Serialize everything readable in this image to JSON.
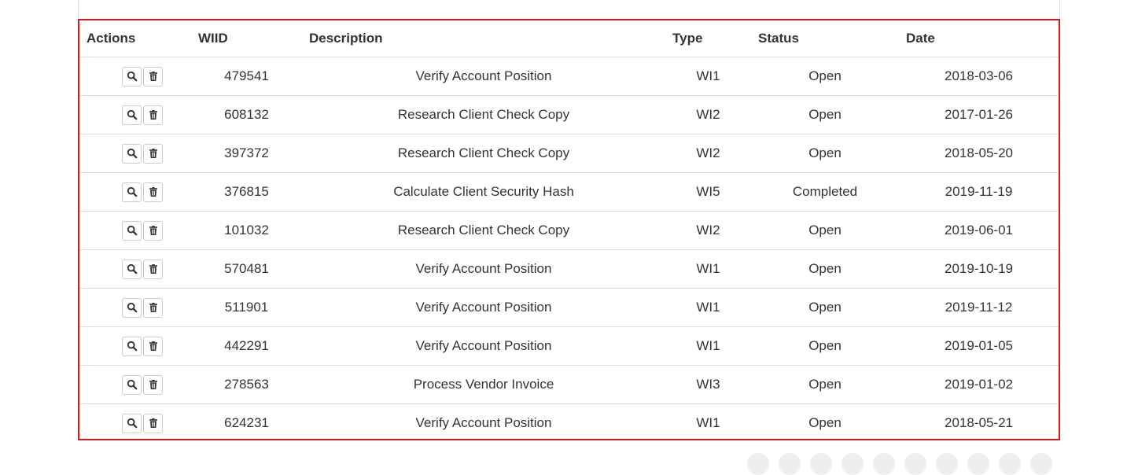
{
  "table": {
    "headers": {
      "actions": "Actions",
      "wiid": "WIID",
      "description": "Description",
      "type": "Type",
      "status": "Status",
      "date": "Date"
    },
    "rows": [
      {
        "wiid": "479541",
        "description": "Verify Account Position",
        "type": "WI1",
        "status": "Open",
        "date": "2018-03-06"
      },
      {
        "wiid": "608132",
        "description": "Research Client Check Copy",
        "type": "WI2",
        "status": "Open",
        "date": "2017-01-26"
      },
      {
        "wiid": "397372",
        "description": "Research Client Check Copy",
        "type": "WI2",
        "status": "Open",
        "date": "2018-05-20"
      },
      {
        "wiid": "376815",
        "description": "Calculate Client Security Hash",
        "type": "WI5",
        "status": "Completed",
        "date": "2019-11-19"
      },
      {
        "wiid": "101032",
        "description": "Research Client Check Copy",
        "type": "WI2",
        "status": "Open",
        "date": "2019-06-01"
      },
      {
        "wiid": "570481",
        "description": "Verify Account Position",
        "type": "WI1",
        "status": "Open",
        "date": "2019-10-19"
      },
      {
        "wiid": "511901",
        "description": "Verify Account Position",
        "type": "WI1",
        "status": "Open",
        "date": "2019-11-12"
      },
      {
        "wiid": "442291",
        "description": "Verify Account Position",
        "type": "WI1",
        "status": "Open",
        "date": "2019-01-05"
      },
      {
        "wiid": "278563",
        "description": "Process Vendor Invoice",
        "type": "WI3",
        "status": "Open",
        "date": "2019-01-02"
      },
      {
        "wiid": "624231",
        "description": "Verify Account Position",
        "type": "WI1",
        "status": "Open",
        "date": "2018-05-21"
      }
    ],
    "row_actions": [
      "search-icon",
      "trash-icon"
    ]
  },
  "colors": {
    "highlight_border": "#d61a1a",
    "row_divider": "#dddddd",
    "text": "#333333"
  }
}
